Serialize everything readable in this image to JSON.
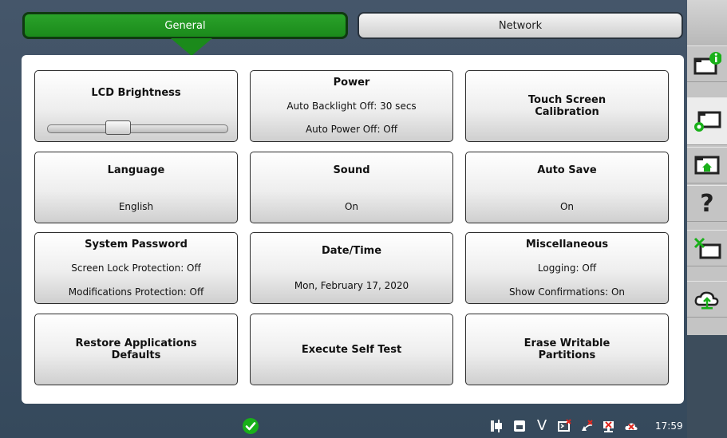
{
  "tabs": {
    "general": "General",
    "network": "Network"
  },
  "tiles": {
    "lcd_brightness": {
      "title": "LCD Brightness",
      "slider_level": 0.38
    },
    "power": {
      "title": "Power",
      "line1": "Auto Backlight Off: 30 secs",
      "line2": "Auto Power Off: Off"
    },
    "touch_screen": {
      "title_line1": "Touch Screen",
      "title_line2": "Calibration"
    },
    "language": {
      "title": "Language",
      "value": "English"
    },
    "sound": {
      "title": "Sound",
      "value": "On"
    },
    "auto_save": {
      "title": "Auto Save",
      "value": "On"
    },
    "system_password": {
      "title": "System Password",
      "line1": "Screen Lock Protection: Off",
      "line2": "Modifications Protection: Off"
    },
    "date_time": {
      "title": "Date/Time",
      "value": "Mon, February 17, 2020"
    },
    "miscellaneous": {
      "title": "Miscellaneous",
      "line1": "Logging: Off",
      "line2": "Show Confirmations: On"
    },
    "restore_defaults": {
      "title_line1": "Restore Applications",
      "title_line2": "Defaults"
    },
    "self_test": {
      "title": "Execute Self Test"
    },
    "erase_partitions": {
      "title_line1": "Erase Writable",
      "title_line2": "Partitions"
    }
  },
  "sidebar": {
    "items": [
      "info-icon",
      "system-settings-icon",
      "home-folder-icon",
      "help-icon",
      "tools-icon",
      "cloud-upload-icon"
    ],
    "help_glyph": "?"
  },
  "statusbar": {
    "letter": "V",
    "clock": "17:59",
    "icons": [
      "status-ok-icon",
      "power-plug-icon",
      "storage-icon",
      "v-indicator",
      "terminal-icon",
      "wifi-off-icon",
      "network-off-icon",
      "cloud-off-icon"
    ]
  },
  "colors": {
    "accent_green": "#1b8a1b",
    "background": "#3d4d5c",
    "panel": "#ffffff",
    "status_ok": "#19b019",
    "error_red": "#e0261d"
  }
}
